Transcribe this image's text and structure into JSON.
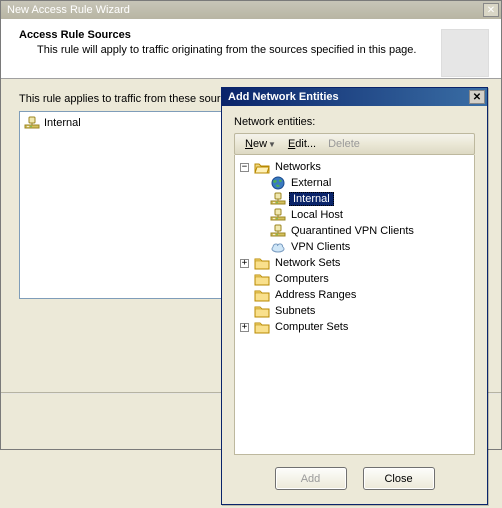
{
  "wizard": {
    "title": "New Access Rule Wizard",
    "header_title": "Access Rule Sources",
    "header_desc": "This rule will apply to traffic originating from the sources specified in this page.",
    "body_label": "This rule applies to traffic from these sour",
    "source_items": [
      {
        "icon": "net-internal",
        "label": "Internal"
      }
    ]
  },
  "entities": {
    "title": "Add Network Entities",
    "label": "Network entities:",
    "toolbar": {
      "new": "New",
      "edit": "Edit...",
      "delete": "Delete"
    },
    "tree": {
      "networks": "Networks",
      "external": "External",
      "internal": "Internal",
      "localhost": "Local Host",
      "qvpn": "Quarantined VPN Clients",
      "vpn": "VPN Clients",
      "network_sets": "Network Sets",
      "computers": "Computers",
      "address_ranges": "Address Ranges",
      "subnets": "Subnets",
      "computer_sets": "Computer Sets"
    },
    "buttons": {
      "add": "Add",
      "close": "Close"
    }
  }
}
